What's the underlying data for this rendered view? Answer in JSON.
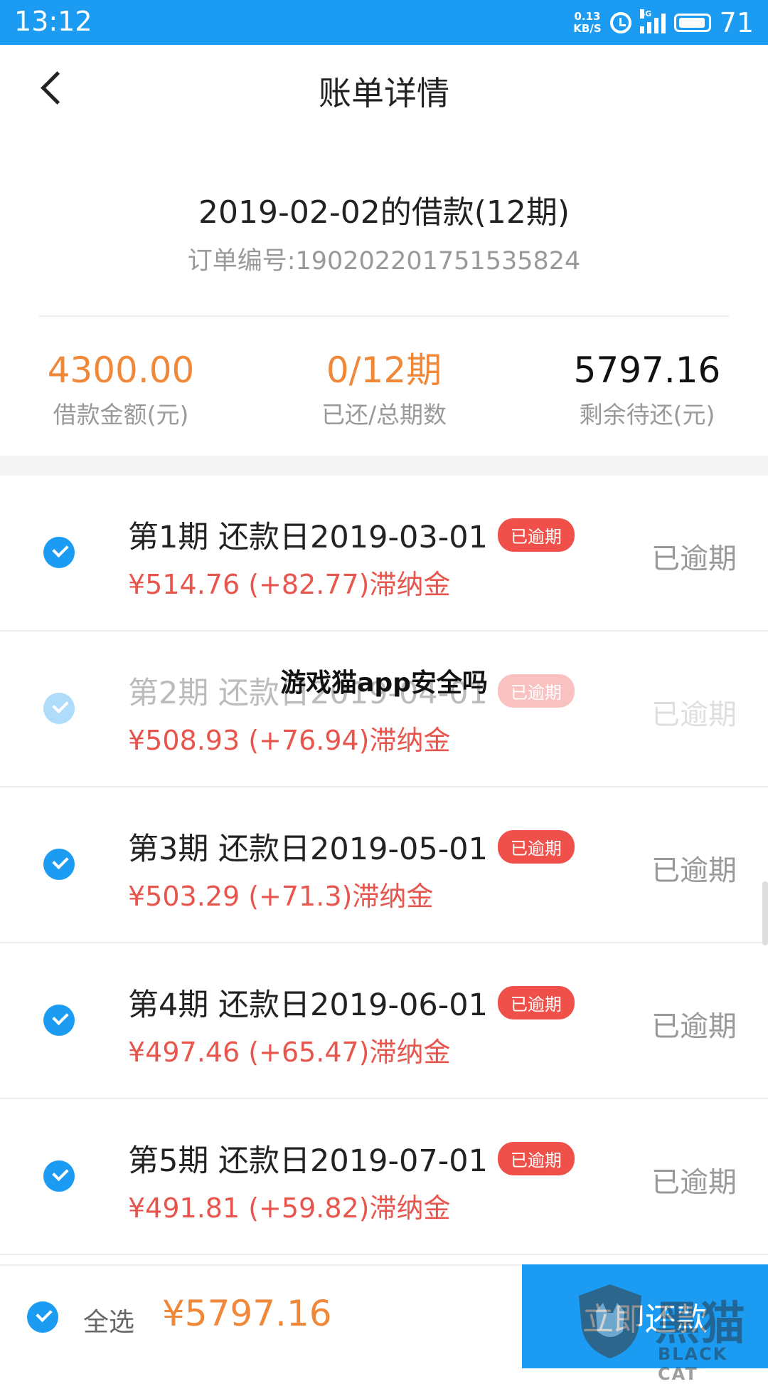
{
  "status_bar": {
    "time": "13:12",
    "speed_value": "0.13",
    "speed_unit": "KB/S",
    "network": "4G",
    "battery": "71"
  },
  "header": {
    "title": "账单详情"
  },
  "loan": {
    "title": "2019-02-02的借款(12期)",
    "order_number": "订单编号:19020220175153582​4"
  },
  "stats": [
    {
      "value": "4300.00",
      "label": "借款金额(元)",
      "color": "#f0883a"
    },
    {
      "value": "0/12期",
      "label": "已还/总期数",
      "color": "#f0883a"
    },
    {
      "value": "5797.16",
      "label": "剩余待还(元)",
      "color": "#111111"
    }
  ],
  "installments": [
    {
      "title": "第1期 还款日2019-03-01",
      "badge": "已逾期",
      "amount": "¥514.76 (+82.77)滞纳金",
      "status": "已逾期"
    },
    {
      "title": "第2期 还款日2019-04-01",
      "badge": "已逾期",
      "amount": "¥508.93 (+76.94)滞纳金",
      "status": "已逾期"
    },
    {
      "title": "第3期 还款日2019-05-01",
      "badge": "已逾期",
      "amount": "¥503.29 (+71.3)滞纳金",
      "status": "已逾期"
    },
    {
      "title": "第4期 还款日2019-06-01",
      "badge": "已逾期",
      "amount": "¥497.46 (+65.47)滞纳金",
      "status": "已逾期"
    },
    {
      "title": "第5期 还款日2019-07-01",
      "badge": "已逾期",
      "amount": "¥491.81 (+59.82)滞纳金",
      "status": "已逾期"
    }
  ],
  "overlay_text": "游戏猫app安全吗",
  "bottom": {
    "select_all": "全选",
    "total": "¥5797.16",
    "pay_button": "立即还款"
  },
  "watermark": {
    "cn": "黑猫",
    "en": "BLACK CAT"
  },
  "colors": {
    "primary": "#1b9cf2",
    "accent_orange": "#f0883a",
    "overdue_red": "#f0504a"
  }
}
